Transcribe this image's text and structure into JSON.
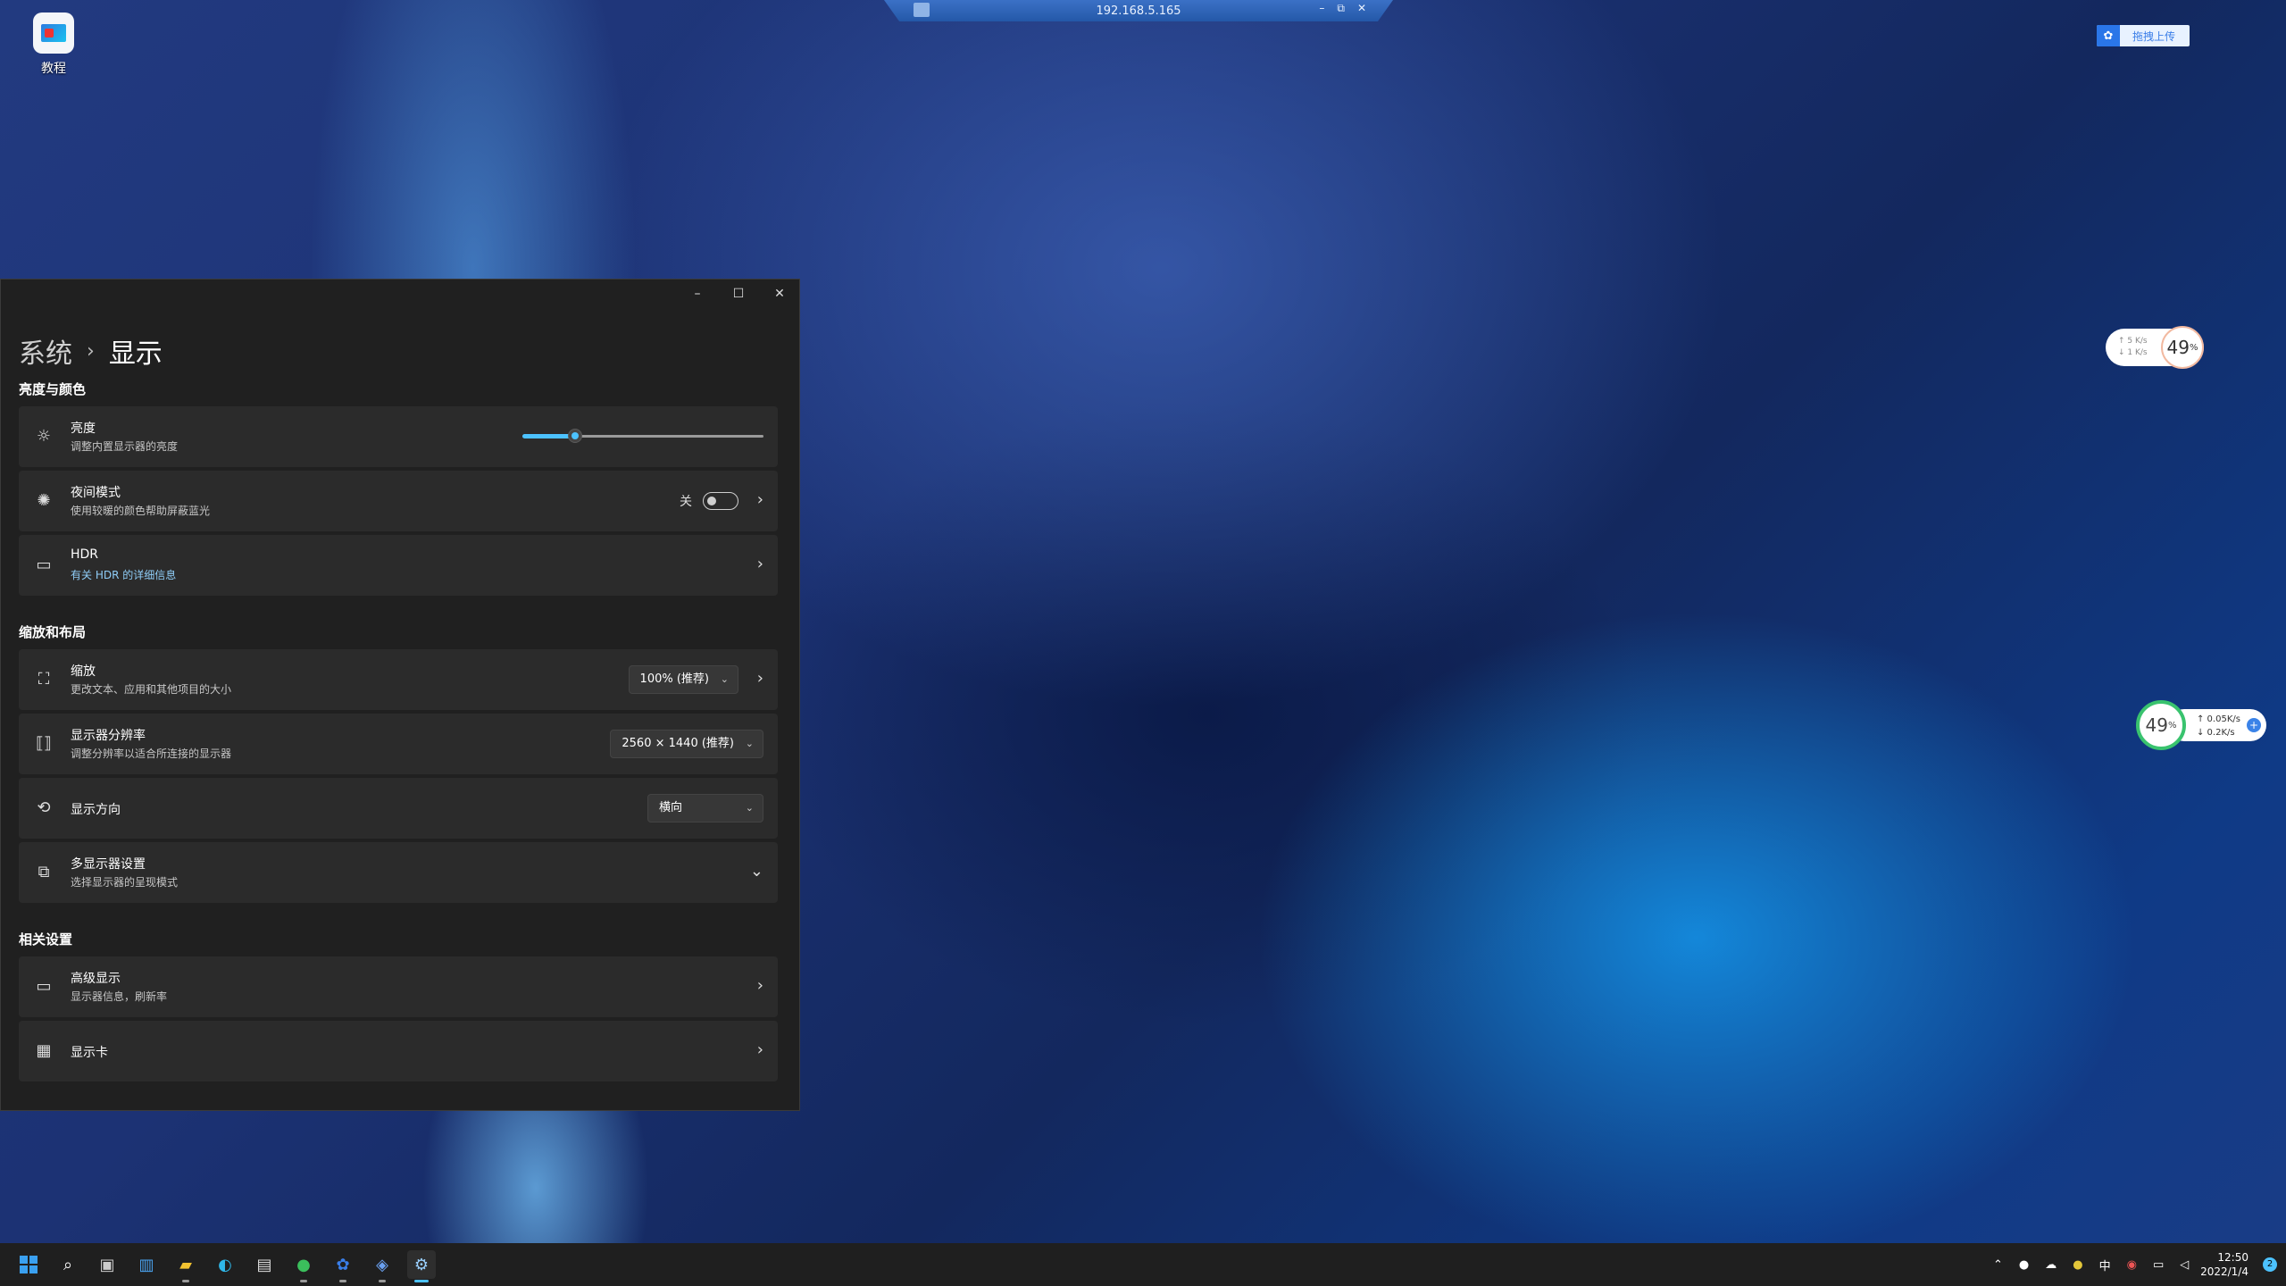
{
  "desktop": {
    "icon_label": "教程"
  },
  "remote_bar": {
    "address": "192.168.5.165",
    "minimize": "–",
    "restore": "⧉",
    "close": "✕"
  },
  "upload_button": {
    "label": "拖拽上传"
  },
  "net_widget_top": {
    "up_rate": "↑ 5  K/s",
    "down_rate": "↓ 1  K/s",
    "percent": "49",
    "percent_unit": "%"
  },
  "net_widget_side": {
    "percent": "49",
    "percent_unit": "%",
    "up_rate": "↑  0.05K/s",
    "down_rate": "↓  0.2K/s"
  },
  "window": {
    "breadcrumb_parent": "系统",
    "breadcrumb_separator": "›",
    "breadcrumb_current": "显示",
    "minimize": "–",
    "maximize": "☐",
    "close": "✕"
  },
  "sections": {
    "brightness_color": "亮度与颜色",
    "scale_layout": "缩放和布局",
    "related": "相关设置"
  },
  "rows": {
    "brightness": {
      "title": "亮度",
      "subtitle": "调整内置显示器的亮度",
      "value": 0.22
    },
    "night_light": {
      "title": "夜间模式",
      "subtitle": "使用较暖的颜色帮助屏蔽蓝光",
      "state": "关"
    },
    "hdr": {
      "title": "HDR",
      "link": "有关 HDR 的详细信息"
    },
    "scale": {
      "title": "缩放",
      "subtitle": "更改文本、应用和其他项目的大小",
      "selected": "100% (推荐)"
    },
    "resolution": {
      "title": "显示器分辨率",
      "subtitle": "调整分辨率以适合所连接的显示器",
      "selected": "2560 × 1440 (推荐)"
    },
    "orientation": {
      "title": "显示方向",
      "selected": "横向"
    },
    "multi_display": {
      "title": "多显示器设置",
      "subtitle": "选择显示器的呈现模式"
    },
    "advanced": {
      "title": "高级显示",
      "subtitle": "显示器信息，刷新率"
    },
    "graphics": {
      "title": "显示卡"
    }
  },
  "icons": {
    "chevron_right": "›",
    "chevron_down": "⌄",
    "sun": "☼",
    "night": "✺",
    "hdr": "▭",
    "scale": "⛶",
    "resolution": "⟦⟧",
    "orientation": "⟲",
    "multi_display": "⧉",
    "advanced": "▭",
    "graphics": "▦"
  },
  "taskbar": {
    "ime": "中",
    "time": "12:50",
    "date": "2022/1/4",
    "notifications": "2"
  },
  "colors": {
    "accent": "#4cc2ff",
    "window_bg": "#202020",
    "card_bg": "#2b2b2b",
    "taskbar_bg": "#1f1f1f"
  }
}
